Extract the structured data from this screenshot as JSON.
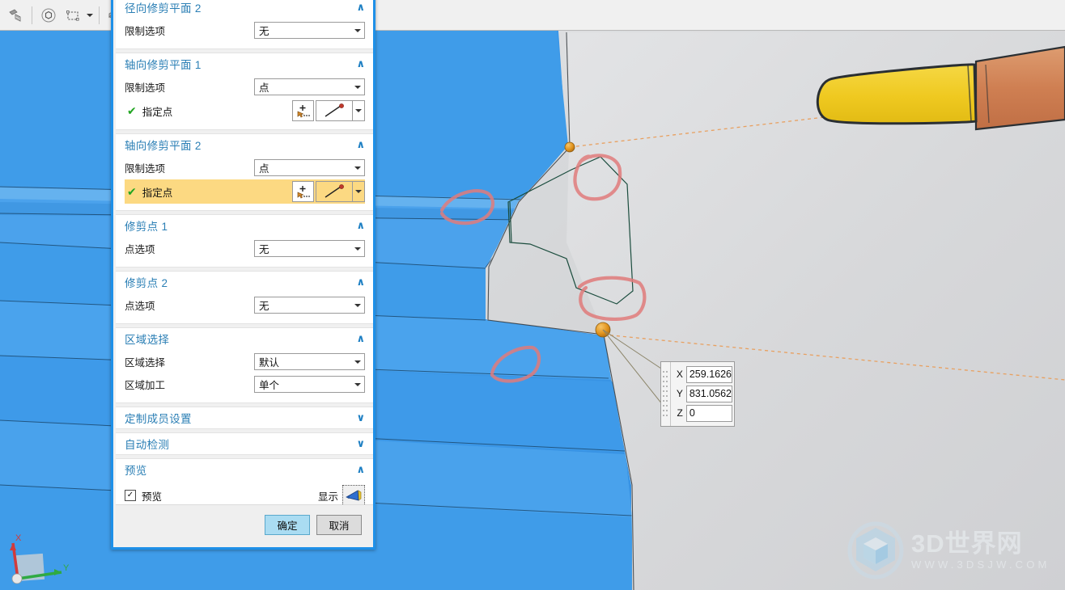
{
  "toolbar": {
    "buttons": [
      {
        "name": "toolpath-icon",
        "title": "Toolpath"
      },
      {
        "name": "hexagon-select-icon",
        "title": "Select Feature"
      },
      {
        "name": "rectangle-select-icon",
        "title": "Rectangle Select"
      },
      {
        "name": "render-style-icon",
        "title": "Render Style"
      },
      {
        "name": "view-orientation-icon",
        "title": "View Orientation"
      }
    ]
  },
  "dialog": {
    "groups": [
      {
        "title": "径向修剪平面 2",
        "expanded": true,
        "chevron": "∧",
        "rows": [
          {
            "type": "combo",
            "label": "限制选项",
            "value": "无"
          }
        ]
      },
      {
        "title": "轴向修剪平面 1",
        "expanded": true,
        "chevron": "∧",
        "rows": [
          {
            "type": "combo",
            "label": "限制选项",
            "value": "点"
          },
          {
            "type": "select",
            "label": "指定点",
            "checked": true,
            "highlight": false
          }
        ]
      },
      {
        "title": "轴向修剪平面 2",
        "expanded": true,
        "chevron": "∧",
        "rows": [
          {
            "type": "combo",
            "label": "限制选项",
            "value": "点"
          },
          {
            "type": "select",
            "label": "指定点",
            "checked": true,
            "highlight": true
          }
        ]
      },
      {
        "title": "修剪点 1",
        "expanded": true,
        "chevron": "∧",
        "rows": [
          {
            "type": "combo",
            "label": "点选项",
            "value": "无"
          }
        ]
      },
      {
        "title": "修剪点 2",
        "expanded": true,
        "chevron": "∧",
        "rows": [
          {
            "type": "combo",
            "label": "点选项",
            "value": "无"
          }
        ]
      },
      {
        "title": "区域选择",
        "expanded": true,
        "chevron": "∧",
        "rows": [
          {
            "type": "combo",
            "label": "区域选择",
            "value": "默认"
          },
          {
            "type": "combo",
            "label": "区域加工",
            "value": "单个"
          }
        ]
      },
      {
        "title": "定制成员设置",
        "expanded": false,
        "chevron": "∨",
        "rows": []
      },
      {
        "title": "自动检测",
        "expanded": false,
        "chevron": "∨",
        "rows": []
      }
    ],
    "preview": {
      "title": "预览",
      "chevron": "∧",
      "checkbox_label": "预览",
      "checkbox_checked": true,
      "checkmark": "✓",
      "display_label": "显示",
      "display_icon": "flashlight-icon"
    },
    "footer": {
      "ok_label": "确定",
      "cancel_label": "取消"
    }
  },
  "coordinate_box": {
    "rows": [
      {
        "axis": "X",
        "value": "259.1626"
      },
      {
        "axis": "Y",
        "value": "831.0562"
      },
      {
        "axis": "Z",
        "value": "0"
      }
    ]
  },
  "watermark": {
    "main": "3D世界网",
    "sub": "WWW.3DSJW.COM"
  },
  "scene": {
    "colors": {
      "part_blue": "#3d9ae8",
      "part_blue_light": "#55a9ee",
      "face_gray": "#d9dadc",
      "tool_yellow": "#f2d02e",
      "tool_shank": "#d08558",
      "marker_orange": "#e59a22",
      "annotation_red": "#e07b7b",
      "curve_green": "#1b4d3e",
      "axis_orange": "#e8a060"
    },
    "triad": {
      "x_label": "X",
      "y_label": "Y"
    }
  }
}
